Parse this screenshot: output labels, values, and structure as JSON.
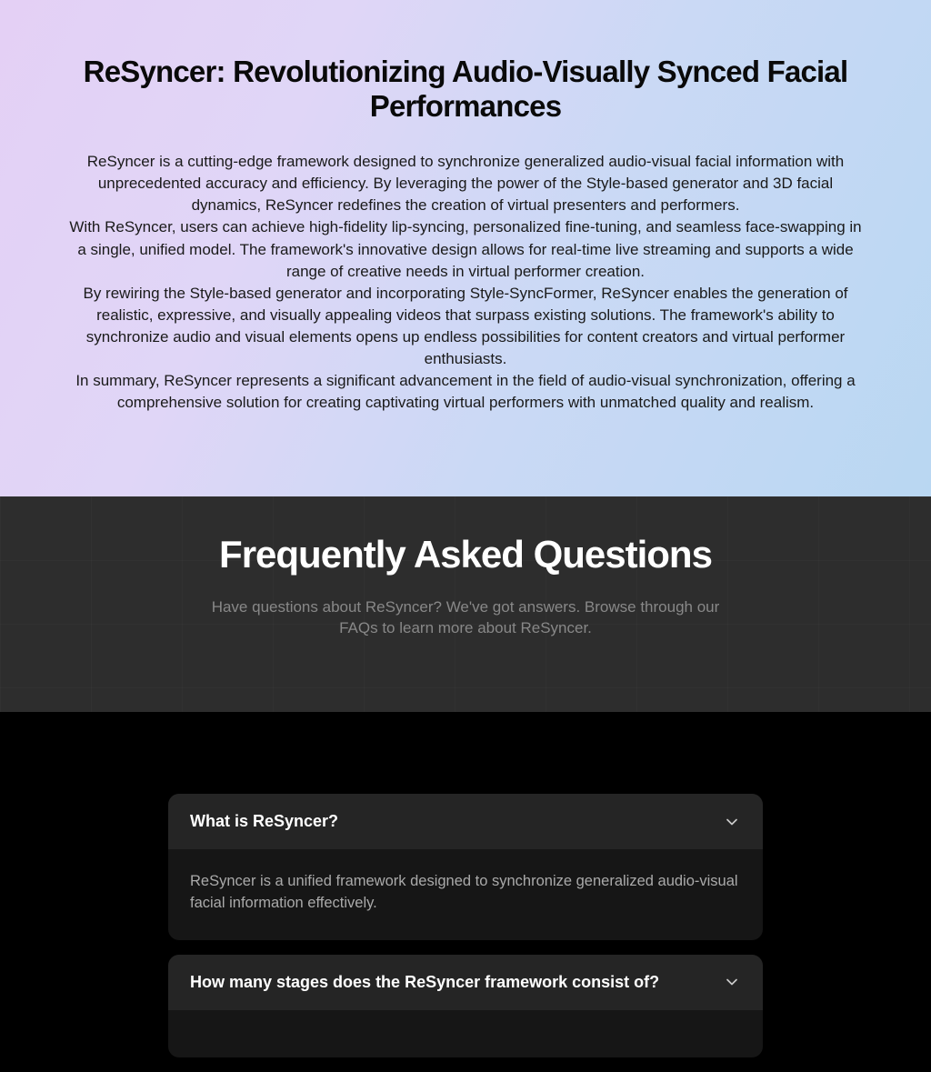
{
  "hero": {
    "title": "ReSyncer: Revolutionizing Audio-Visually Synced Facial Performances",
    "p1": "ReSyncer is a cutting-edge framework designed to synchronize generalized audio-visual facial information with unprecedented accuracy and efficiency. By leveraging the power of the Style-based generator and 3D facial dynamics, ReSyncer redefines the creation of virtual presenters and performers.",
    "p2": "With ReSyncer, users can achieve high-fidelity lip-syncing, personalized fine-tuning, and seamless face-swapping in a single, unified model. The framework's innovative design allows for real-time live streaming and supports a wide range of creative needs in virtual performer creation.",
    "p3": "By rewiring the Style-based generator and incorporating Style-SyncFormer, ReSyncer enables the generation of realistic, expressive, and visually appealing videos that surpass existing solutions. The framework's ability to synchronize audio and visual elements opens up endless possibilities for content creators and virtual performer enthusiasts.",
    "p4": "In summary, ReSyncer represents a significant advancement in the field of audio-visual synchronization, offering a comprehensive solution for creating captivating virtual performers with unmatched quality and realism."
  },
  "faq": {
    "title": "Frequently Asked Questions",
    "subtitle": "Have questions about ReSyncer? We've got answers. Browse through our FAQs to learn more about ReSyncer.",
    "items": [
      {
        "q": "What is ReSyncer?",
        "a": "ReSyncer is a unified framework designed to synchronize generalized audio-visual facial information effectively."
      },
      {
        "q": "How many stages does the ReSyncer framework consist of?",
        "a": ""
      }
    ]
  }
}
